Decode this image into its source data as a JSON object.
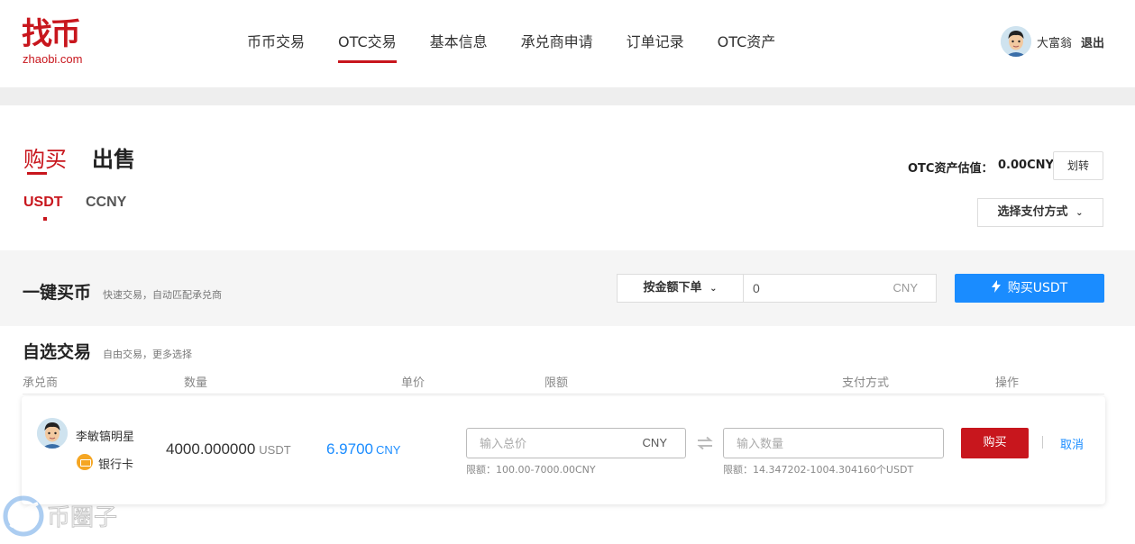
{
  "brand": {
    "logo_text": "找币",
    "url_text": "zhaobi.com",
    "accent": "#c8161d"
  },
  "nav": {
    "items": [
      {
        "label": "币币交易"
      },
      {
        "label": "OTC交易",
        "active": true
      },
      {
        "label": "基本信息"
      },
      {
        "label": "承兑商申请"
      },
      {
        "label": "订单记录"
      },
      {
        "label": "OTC资产"
      }
    ]
  },
  "user": {
    "name": "大富翁",
    "logout": "退出"
  },
  "trade_tabs": {
    "buy": "购买",
    "sell": "出售",
    "active": "购买"
  },
  "coin_tabs": {
    "usdt": "USDT",
    "ccny": "CCNY",
    "active": "USDT"
  },
  "asset": {
    "label": "OTC资产估值：",
    "value": "0.00CNY",
    "transfer": "划转"
  },
  "payment_select": {
    "label": "选择支付方式"
  },
  "quick_buy": {
    "title": "一键买币",
    "subtitle": "快速交易，自动匹配承兑商",
    "mode": "按金额下单",
    "amount_value": "0",
    "amount_unit": "CNY",
    "button": "购买USDT",
    "button_color": "#1a8cff"
  },
  "self_select": {
    "title": "自选交易",
    "subtitle": "自由交易，更多选择",
    "columns": [
      "承兑商",
      "数量",
      "单价",
      "限额",
      "支付方式",
      "操作"
    ]
  },
  "order": {
    "merchant": "李敏镐明星",
    "payment": "银行卡",
    "quantity": "4000.000000",
    "quantity_unit": "USDT",
    "price": "6.9700",
    "price_unit": "CNY",
    "total_placeholder": "输入总价",
    "total_unit": "CNY",
    "total_limit": "限额：100.00-7000.00CNY",
    "qty_placeholder": "输入数量",
    "qty_limit": "限额：14.347202-1004.304160个USDT",
    "buy_button": "购买",
    "cancel": "取消"
  },
  "watermark": {
    "text": "币圈子"
  }
}
